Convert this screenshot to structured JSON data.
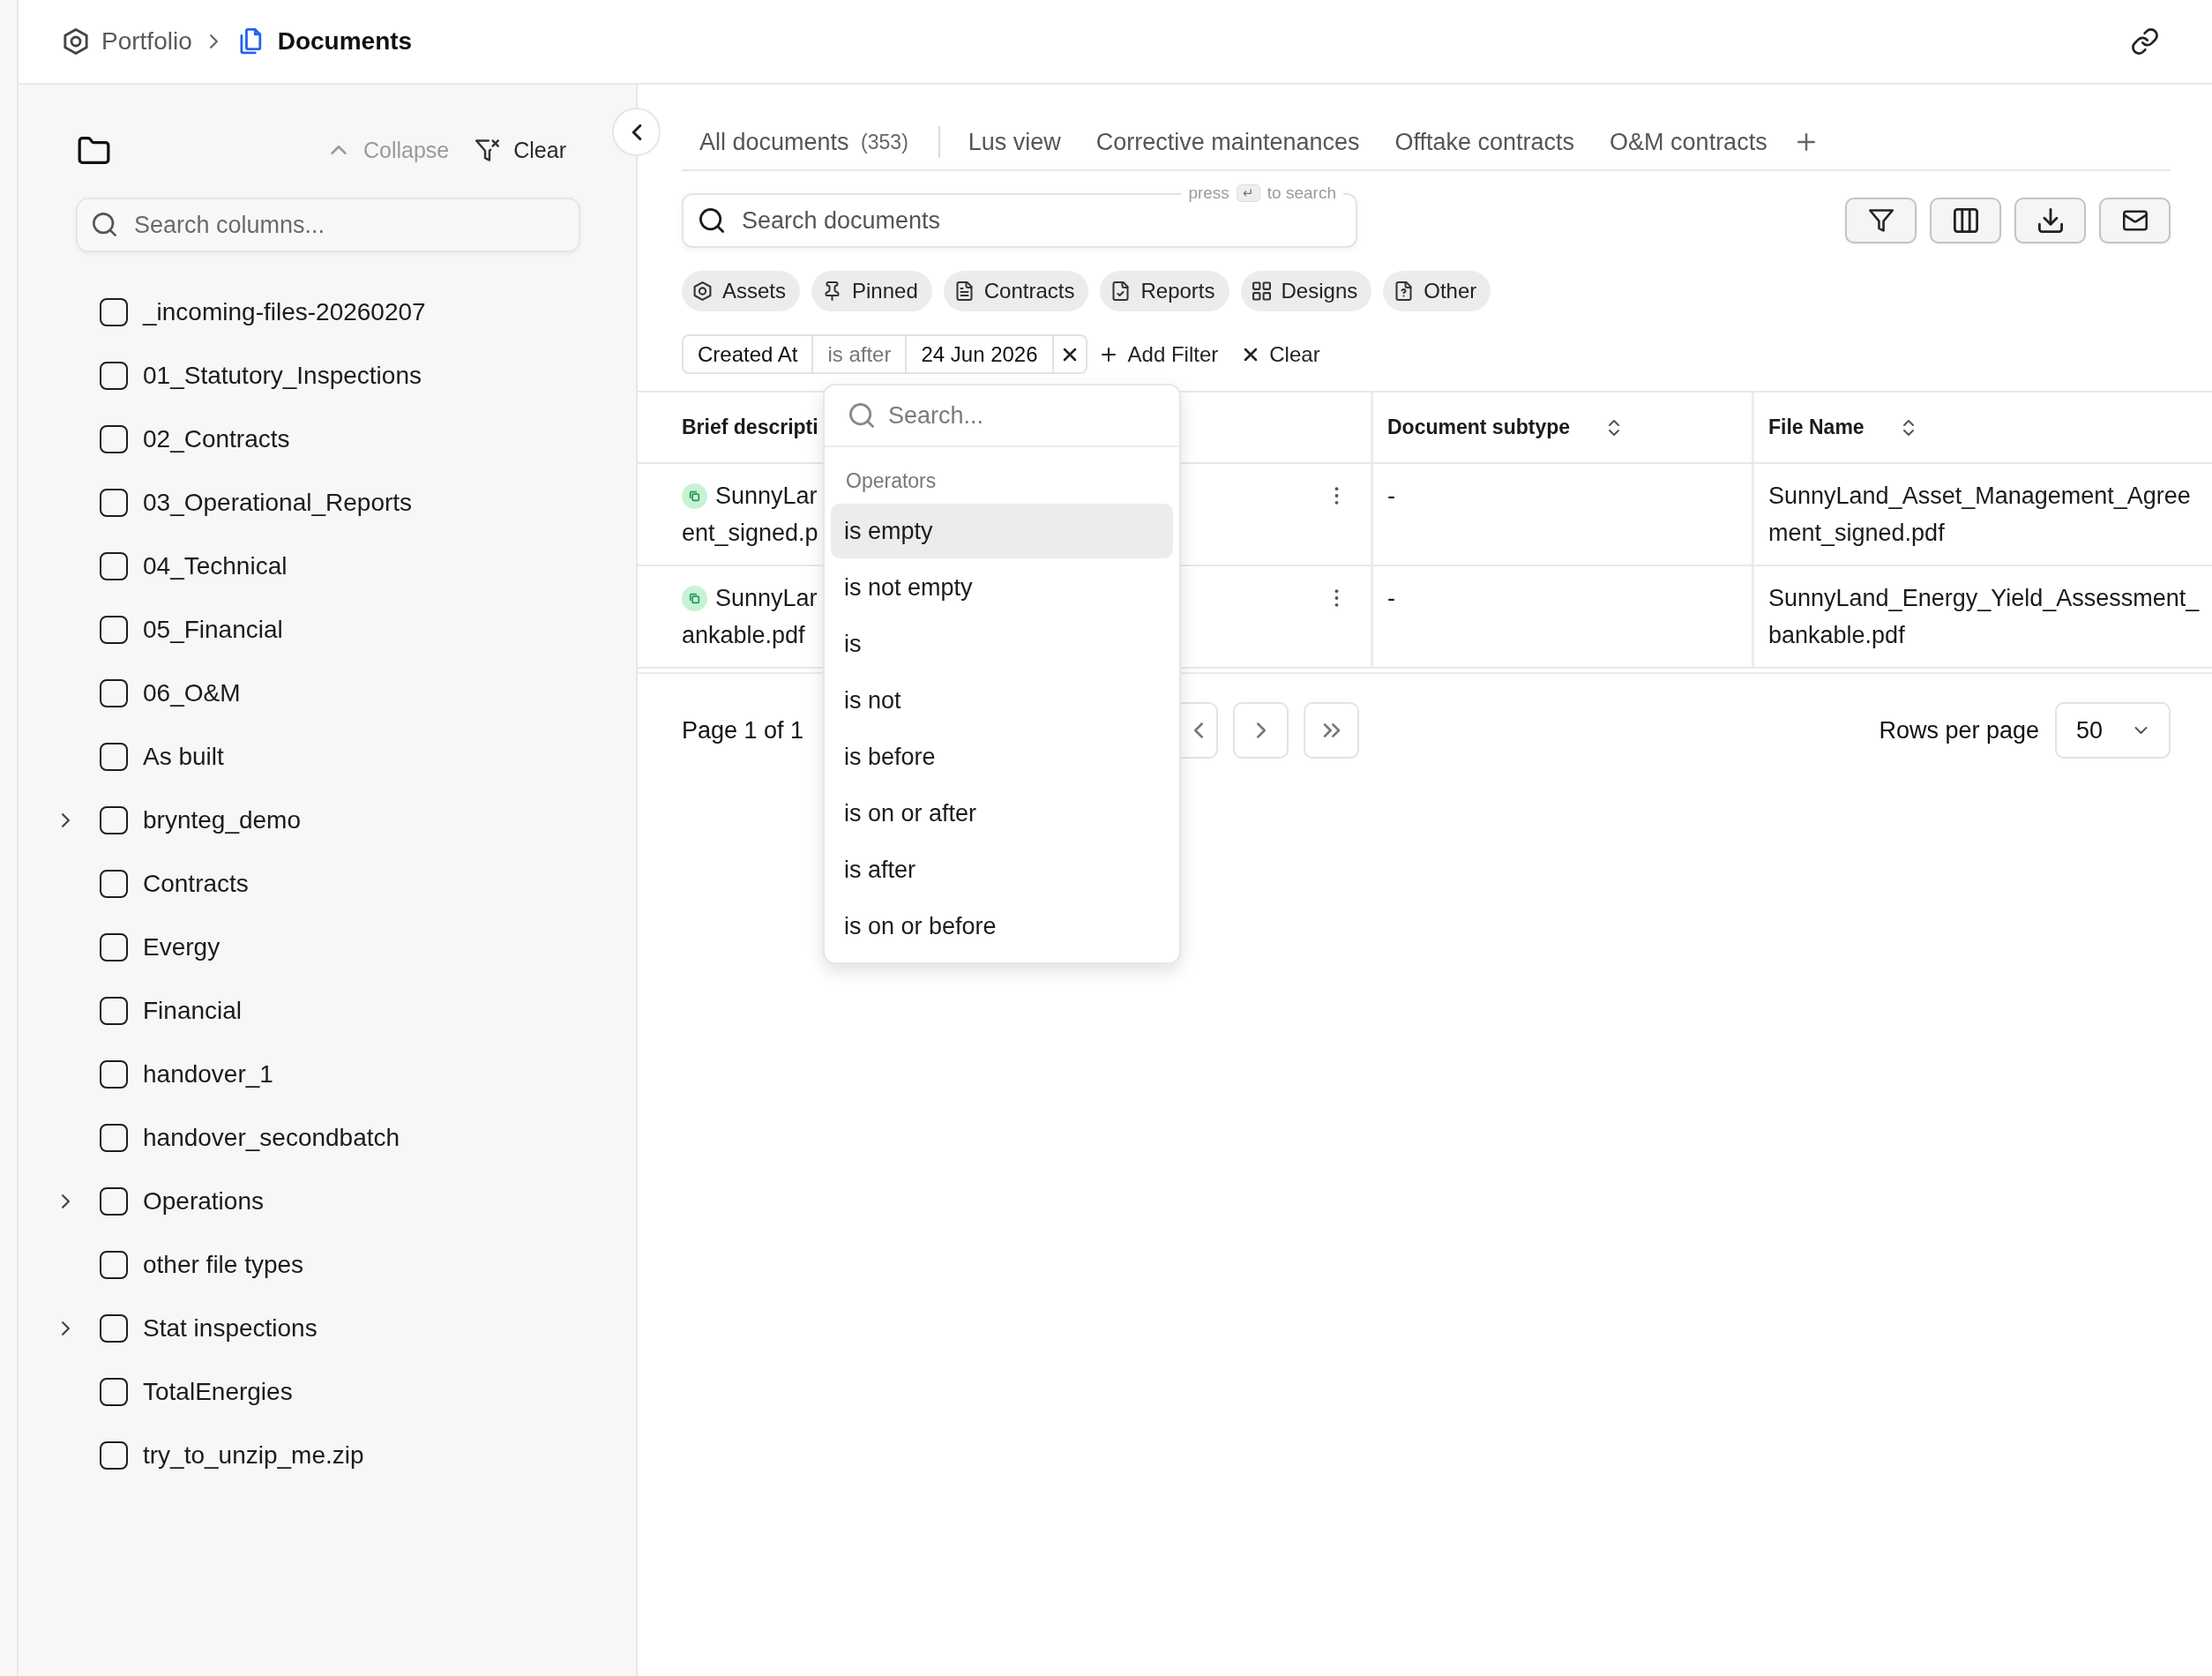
{
  "breadcrumb": [
    {
      "label": "Portfolio",
      "kind": "portfolio",
      "current": false
    },
    {
      "label": "Documents",
      "kind": "documents",
      "current": true
    }
  ],
  "sidebar": {
    "collapse": "Collapse",
    "clear": "Clear",
    "search": {
      "placeholder": "Search columns..."
    },
    "folders": [
      {
        "label": "_incoming-files-20260207",
        "checked": false
      },
      {
        "label": "01_Statutory_Inspections",
        "checked": false
      },
      {
        "label": "02_Contracts",
        "checked": false
      },
      {
        "label": "03_Operational_Reports",
        "checked": false
      },
      {
        "label": "04_Technical",
        "checked": false
      },
      {
        "label": "05_Financial",
        "checked": false
      },
      {
        "label": "06_O&M",
        "checked": false
      },
      {
        "label": "As built",
        "checked": false
      },
      {
        "label": "brynteg_demo",
        "checked": false,
        "expanded": false
      },
      {
        "label": "Contracts",
        "checked": false
      },
      {
        "label": "Evergy",
        "checked": false
      },
      {
        "label": "Financial",
        "checked": false
      },
      {
        "label": "handover_1",
        "checked": false
      },
      {
        "label": "handover_secondbatch",
        "checked": false
      },
      {
        "label": "Operations",
        "checked": false,
        "expanded": false
      },
      {
        "label": "other file types",
        "checked": false
      },
      {
        "label": "Stat inspections",
        "checked": false,
        "expanded": false
      },
      {
        "label": "TotalEnergies",
        "checked": false
      },
      {
        "label": "try_to_unzip_me.zip",
        "checked": false
      }
    ]
  },
  "tabs": [
    {
      "label": "All documents",
      "count": "(353)",
      "kind": "all"
    },
    {
      "label": "Lus view",
      "kind": "view"
    },
    {
      "label": "Corrective maintenances",
      "kind": "view"
    },
    {
      "label": "Offtake contracts",
      "kind": "view"
    },
    {
      "label": "O&M contracts",
      "kind": "view"
    }
  ],
  "document_search": {
    "placeholder": "Search documents",
    "hint_prefix": "press",
    "hint_key": "↵",
    "hint_suffix": "to search"
  },
  "categories": [
    {
      "label": "Assets",
      "kind": "assets"
    },
    {
      "label": "Pinned",
      "kind": "pinned"
    },
    {
      "label": "Contracts",
      "kind": "contracts"
    },
    {
      "label": "Reports",
      "kind": "reports"
    },
    {
      "label": "Designs",
      "kind": "designs"
    },
    {
      "label": "Other",
      "kind": "other"
    }
  ],
  "filters": [
    {
      "field": "Created At",
      "operator": "is after",
      "value": "24 Jun 2026"
    }
  ],
  "add_filter": "Add Filter",
  "clear_filters": "Clear",
  "table": {
    "columns": [
      {
        "label": "Brief descripti",
        "sortable": false
      },
      {
        "label": "Document subtype",
        "sortable": true
      },
      {
        "label": "File Name",
        "sortable": true
      }
    ],
    "rows": [
      {
        "brief_description": [
          "SunnyLar",
          "ent_signed.p"
        ],
        "document_subtype": "-",
        "file_name": "SunnyLand_Asset_Management_Agreement_signed.pdf"
      },
      {
        "brief_description": [
          "SunnyLar",
          "ankable.pdf"
        ],
        "document_subtype": "-",
        "file_name": "SunnyLand_Energy_Yield_Assessment_bankable.pdf"
      }
    ]
  },
  "pagination": {
    "page": "Page 1 of 1",
    "rows_per_page_label": "Rows per page",
    "rows_per_page": "50"
  },
  "operator_menu": {
    "placeholder": "Search...",
    "group": "Operators",
    "options": [
      {
        "label": "is empty",
        "selected": true
      },
      {
        "label": "is not empty",
        "selected": false
      },
      {
        "label": "is",
        "selected": false
      },
      {
        "label": "is not",
        "selected": false
      },
      {
        "label": "is before",
        "selected": false
      },
      {
        "label": "is on or after",
        "selected": false
      },
      {
        "label": "is after",
        "selected": false
      },
      {
        "label": "is on or before",
        "selected": false
      }
    ]
  }
}
